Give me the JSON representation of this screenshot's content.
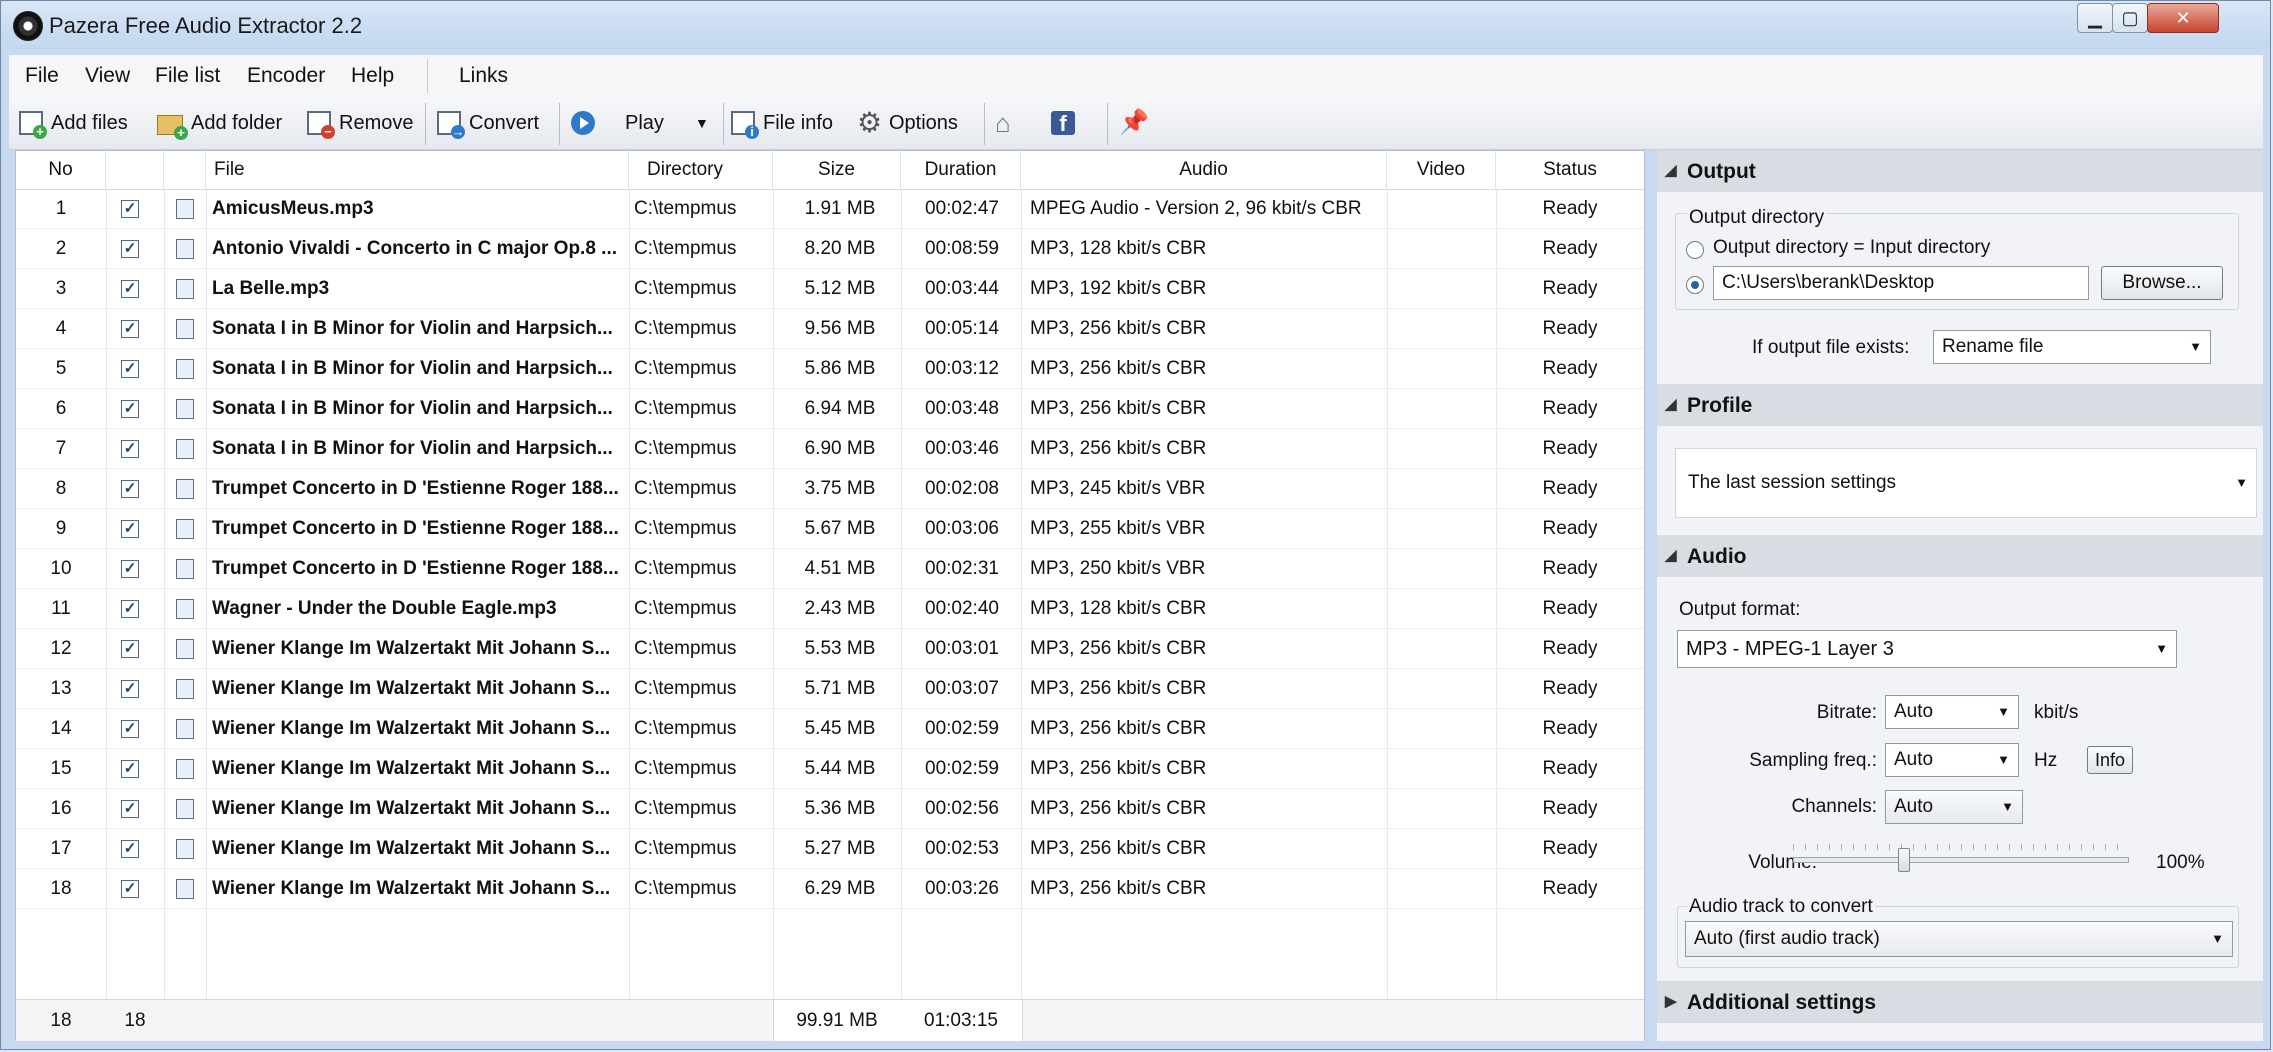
{
  "window": {
    "title": "Pazera Free Audio Extractor 2.2"
  },
  "menu": [
    "File",
    "View",
    "File list",
    "Encoder",
    "Help",
    "Links"
  ],
  "toolbar": {
    "add_files": "Add files",
    "add_folder": "Add folder",
    "remove": "Remove",
    "convert": "Convert",
    "play": "Play",
    "file_info": "File info",
    "options": "Options"
  },
  "columns": [
    "No",
    "File",
    "Directory",
    "Size",
    "Duration",
    "Audio",
    "Video",
    "Status"
  ],
  "files": [
    {
      "no": "1",
      "file": "AmicusMeus.mp3",
      "dir": "C:\\tempmus",
      "size": "1.91 MB",
      "duration": "00:02:47",
      "audio": "MPEG Audio - Version 2, 96 kbit/s  CBR",
      "status": "Ready"
    },
    {
      "no": "2",
      "file": "Antonio Vivaldi - Concerto in C major Op.8 ...",
      "dir": "C:\\tempmus",
      "size": "8.20 MB",
      "duration": "00:08:59",
      "audio": "MP3, 128 kbit/s  CBR",
      "status": "Ready"
    },
    {
      "no": "3",
      "file": "La Belle.mp3",
      "dir": "C:\\tempmus",
      "size": "5.12 MB",
      "duration": "00:03:44",
      "audio": "MP3, 192 kbit/s  CBR",
      "status": "Ready"
    },
    {
      "no": "4",
      "file": "Sonata I in B Minor for Violin and Harpsich...",
      "dir": "C:\\tempmus",
      "size": "9.56 MB",
      "duration": "00:05:14",
      "audio": "MP3, 256 kbit/s  CBR",
      "status": "Ready"
    },
    {
      "no": "5",
      "file": "Sonata I in B Minor for Violin and Harpsich...",
      "dir": "C:\\tempmus",
      "size": "5.86 MB",
      "duration": "00:03:12",
      "audio": "MP3, 256 kbit/s  CBR",
      "status": "Ready"
    },
    {
      "no": "6",
      "file": "Sonata I in B Minor for Violin and Harpsich...",
      "dir": "C:\\tempmus",
      "size": "6.94 MB",
      "duration": "00:03:48",
      "audio": "MP3, 256 kbit/s  CBR",
      "status": "Ready"
    },
    {
      "no": "7",
      "file": "Sonata I in B Minor for Violin and Harpsich...",
      "dir": "C:\\tempmus",
      "size": "6.90 MB",
      "duration": "00:03:46",
      "audio": "MP3, 256 kbit/s  CBR",
      "status": "Ready"
    },
    {
      "no": "8",
      "file": "Trumpet Concerto in D 'Estienne Roger 188...",
      "dir": "C:\\tempmus",
      "size": "3.75 MB",
      "duration": "00:02:08",
      "audio": "MP3, 245 kbit/s  VBR",
      "status": "Ready"
    },
    {
      "no": "9",
      "file": "Trumpet Concerto in D 'Estienne Roger 188...",
      "dir": "C:\\tempmus",
      "size": "5.67 MB",
      "duration": "00:03:06",
      "audio": "MP3, 255 kbit/s  VBR",
      "status": "Ready"
    },
    {
      "no": "10",
      "file": "Trumpet Concerto in D 'Estienne Roger 188...",
      "dir": "C:\\tempmus",
      "size": "4.51 MB",
      "duration": "00:02:31",
      "audio": "MP3, 250 kbit/s  VBR",
      "status": "Ready"
    },
    {
      "no": "11",
      "file": "Wagner - Under the Double Eagle.mp3",
      "dir": "C:\\tempmus",
      "size": "2.43 MB",
      "duration": "00:02:40",
      "audio": "MP3, 128 kbit/s  CBR",
      "status": "Ready"
    },
    {
      "no": "12",
      "file": "Wiener Klange Im Walzertakt Mit Johann S...",
      "dir": "C:\\tempmus",
      "size": "5.53 MB",
      "duration": "00:03:01",
      "audio": "MP3, 256 kbit/s  CBR",
      "status": "Ready"
    },
    {
      "no": "13",
      "file": "Wiener Klange Im Walzertakt Mit Johann S...",
      "dir": "C:\\tempmus",
      "size": "5.71 MB",
      "duration": "00:03:07",
      "audio": "MP3, 256 kbit/s  CBR",
      "status": "Ready"
    },
    {
      "no": "14",
      "file": "Wiener Klange Im Walzertakt Mit Johann S...",
      "dir": "C:\\tempmus",
      "size": "5.45 MB",
      "duration": "00:02:59",
      "audio": "MP3, 256 kbit/s  CBR",
      "status": "Ready"
    },
    {
      "no": "15",
      "file": "Wiener Klange Im Walzertakt Mit Johann S...",
      "dir": "C:\\tempmus",
      "size": "5.44 MB",
      "duration": "00:02:59",
      "audio": "MP3, 256 kbit/s  CBR",
      "status": "Ready"
    },
    {
      "no": "16",
      "file": "Wiener Klange Im Walzertakt Mit Johann S...",
      "dir": "C:\\tempmus",
      "size": "5.36 MB",
      "duration": "00:02:56",
      "audio": "MP3, 256 kbit/s  CBR",
      "status": "Ready"
    },
    {
      "no": "17",
      "file": "Wiener Klange Im Walzertakt Mit Johann S...",
      "dir": "C:\\tempmus",
      "size": "5.27 MB",
      "duration": "00:02:53",
      "audio": "MP3, 256 kbit/s  CBR",
      "status": "Ready"
    },
    {
      "no": "18",
      "file": "Wiener Klange Im Walzertakt Mit Johann S...",
      "dir": "C:\\tempmus",
      "size": "6.29 MB",
      "duration": "00:03:26",
      "audio": "MP3, 256 kbit/s  CBR",
      "status": "Ready"
    }
  ],
  "footer": {
    "count": "18",
    "checked": "18",
    "total_size": "99.91 MB",
    "total_duration": "01:03:15"
  },
  "output": {
    "section": "Output",
    "group": "Output directory",
    "opt_input": "Output directory = Input directory",
    "dir_value": "C:\\Users\\berank\\Desktop",
    "browse": "Browse...",
    "exists_label": "If output file exists:",
    "exists_value": "Rename file"
  },
  "profile": {
    "section": "Profile",
    "value": "The last session settings"
  },
  "audio": {
    "section": "Audio",
    "format_label": "Output format:",
    "format_value": "MP3 - MPEG-1 Layer 3",
    "bitrate_label": "Bitrate:",
    "bitrate_value": "Auto",
    "bitrate_unit": "kbit/s",
    "sampling_label": "Sampling freq.:",
    "sampling_value": "Auto",
    "sampling_unit": "Hz",
    "info": "Info",
    "channels_label": "Channels:",
    "channels_value": "Auto",
    "volume_label": "Volume:",
    "volume_value": "100%",
    "volume_level": 0.33,
    "track_group": "Audio track to convert",
    "track_value": "Auto (first audio track)"
  },
  "additional": {
    "section": "Additional settings"
  }
}
